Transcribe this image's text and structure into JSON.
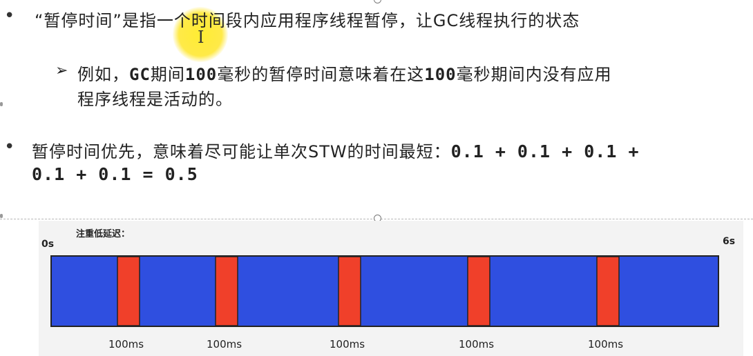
{
  "slide": {
    "bullet1": {
      "quote_open": "“暂停时间”",
      "rest": "是指一个时间段内应用程序线程暂停，让GC线程执行的状态",
      "sub_line1_a": "例如，",
      "sub_line1_b": "GC",
      "sub_line1_c": "期间",
      "sub_line1_d": "100",
      "sub_line1_e": "毫秒的暂停时间意味着在这",
      "sub_line1_f": "100",
      "sub_line1_g": "毫秒期间内没有应用",
      "sub_line2": "程序线程是活动的。"
    },
    "bullet2": {
      "line1_text": "暂停时间优先，意味着尽可能让单次STW的时间最短：",
      "line1_formula": "0.1 + 0.1 + 0.1 +",
      "line2_formula": "0.1 + 0.1 = 0.5"
    }
  },
  "diagram": {
    "title": "注重低延迟：",
    "start_label": "0s",
    "end_label": "6s",
    "pause_labels": [
      "100ms",
      "100ms",
      "100ms",
      "100ms",
      "100ms"
    ],
    "colors": {
      "run": "#2f4fe0",
      "pause": "#f0402a",
      "border": "#222222"
    }
  }
}
